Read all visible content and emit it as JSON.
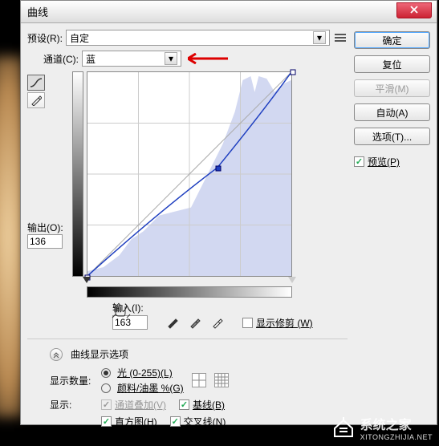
{
  "title": "曲线",
  "preset": {
    "label": "预设(R):",
    "value": "自定"
  },
  "channel": {
    "label": "通道(C):",
    "value": "蓝"
  },
  "output": {
    "label": "输出(O):",
    "value": "136"
  },
  "input": {
    "label": "输入(I):",
    "value": "163"
  },
  "show_clipping": "显示修剪 (W)",
  "curve_display_options": "曲线显示选项",
  "show_amount": {
    "label": "显示数量:",
    "opt_light": "光 (0-255)(L)",
    "opt_pigment": "颜料/油墨 %(G)"
  },
  "show": {
    "label": "显示:",
    "channel_overlay": "通道叠加(V)",
    "baseline": "基线(B)",
    "histogram": "直方图(H)",
    "intersection": "交叉线(N)"
  },
  "buttons": {
    "ok": "确定",
    "reset": "复位",
    "smooth": "平滑(M)",
    "auto": "自动(A)",
    "options": "选项(T)...",
    "preview": "预览(P)"
  },
  "chart_data": {
    "type": "curve",
    "xlabel": "输入",
    "ylabel": "输出",
    "xlim": [
      0,
      255
    ],
    "ylim": [
      0,
      255
    ],
    "baseline": [
      [
        0,
        0
      ],
      [
        255,
        255
      ]
    ],
    "curve_points": [
      [
        0,
        0
      ],
      [
        163,
        136
      ],
      [
        255,
        255
      ]
    ],
    "selected_point": [
      163,
      136
    ],
    "histogram_channel": "蓝",
    "histogram_peaks": [
      {
        "x": 200,
        "h": 0.95
      },
      {
        "x": 220,
        "h": 0.98
      },
      {
        "x": 100,
        "h": 0.35
      },
      {
        "x": 50,
        "h": 0.2
      }
    ]
  },
  "watermark": {
    "brand": "系统之家",
    "url": "XITONGZHIJIA.NET"
  }
}
